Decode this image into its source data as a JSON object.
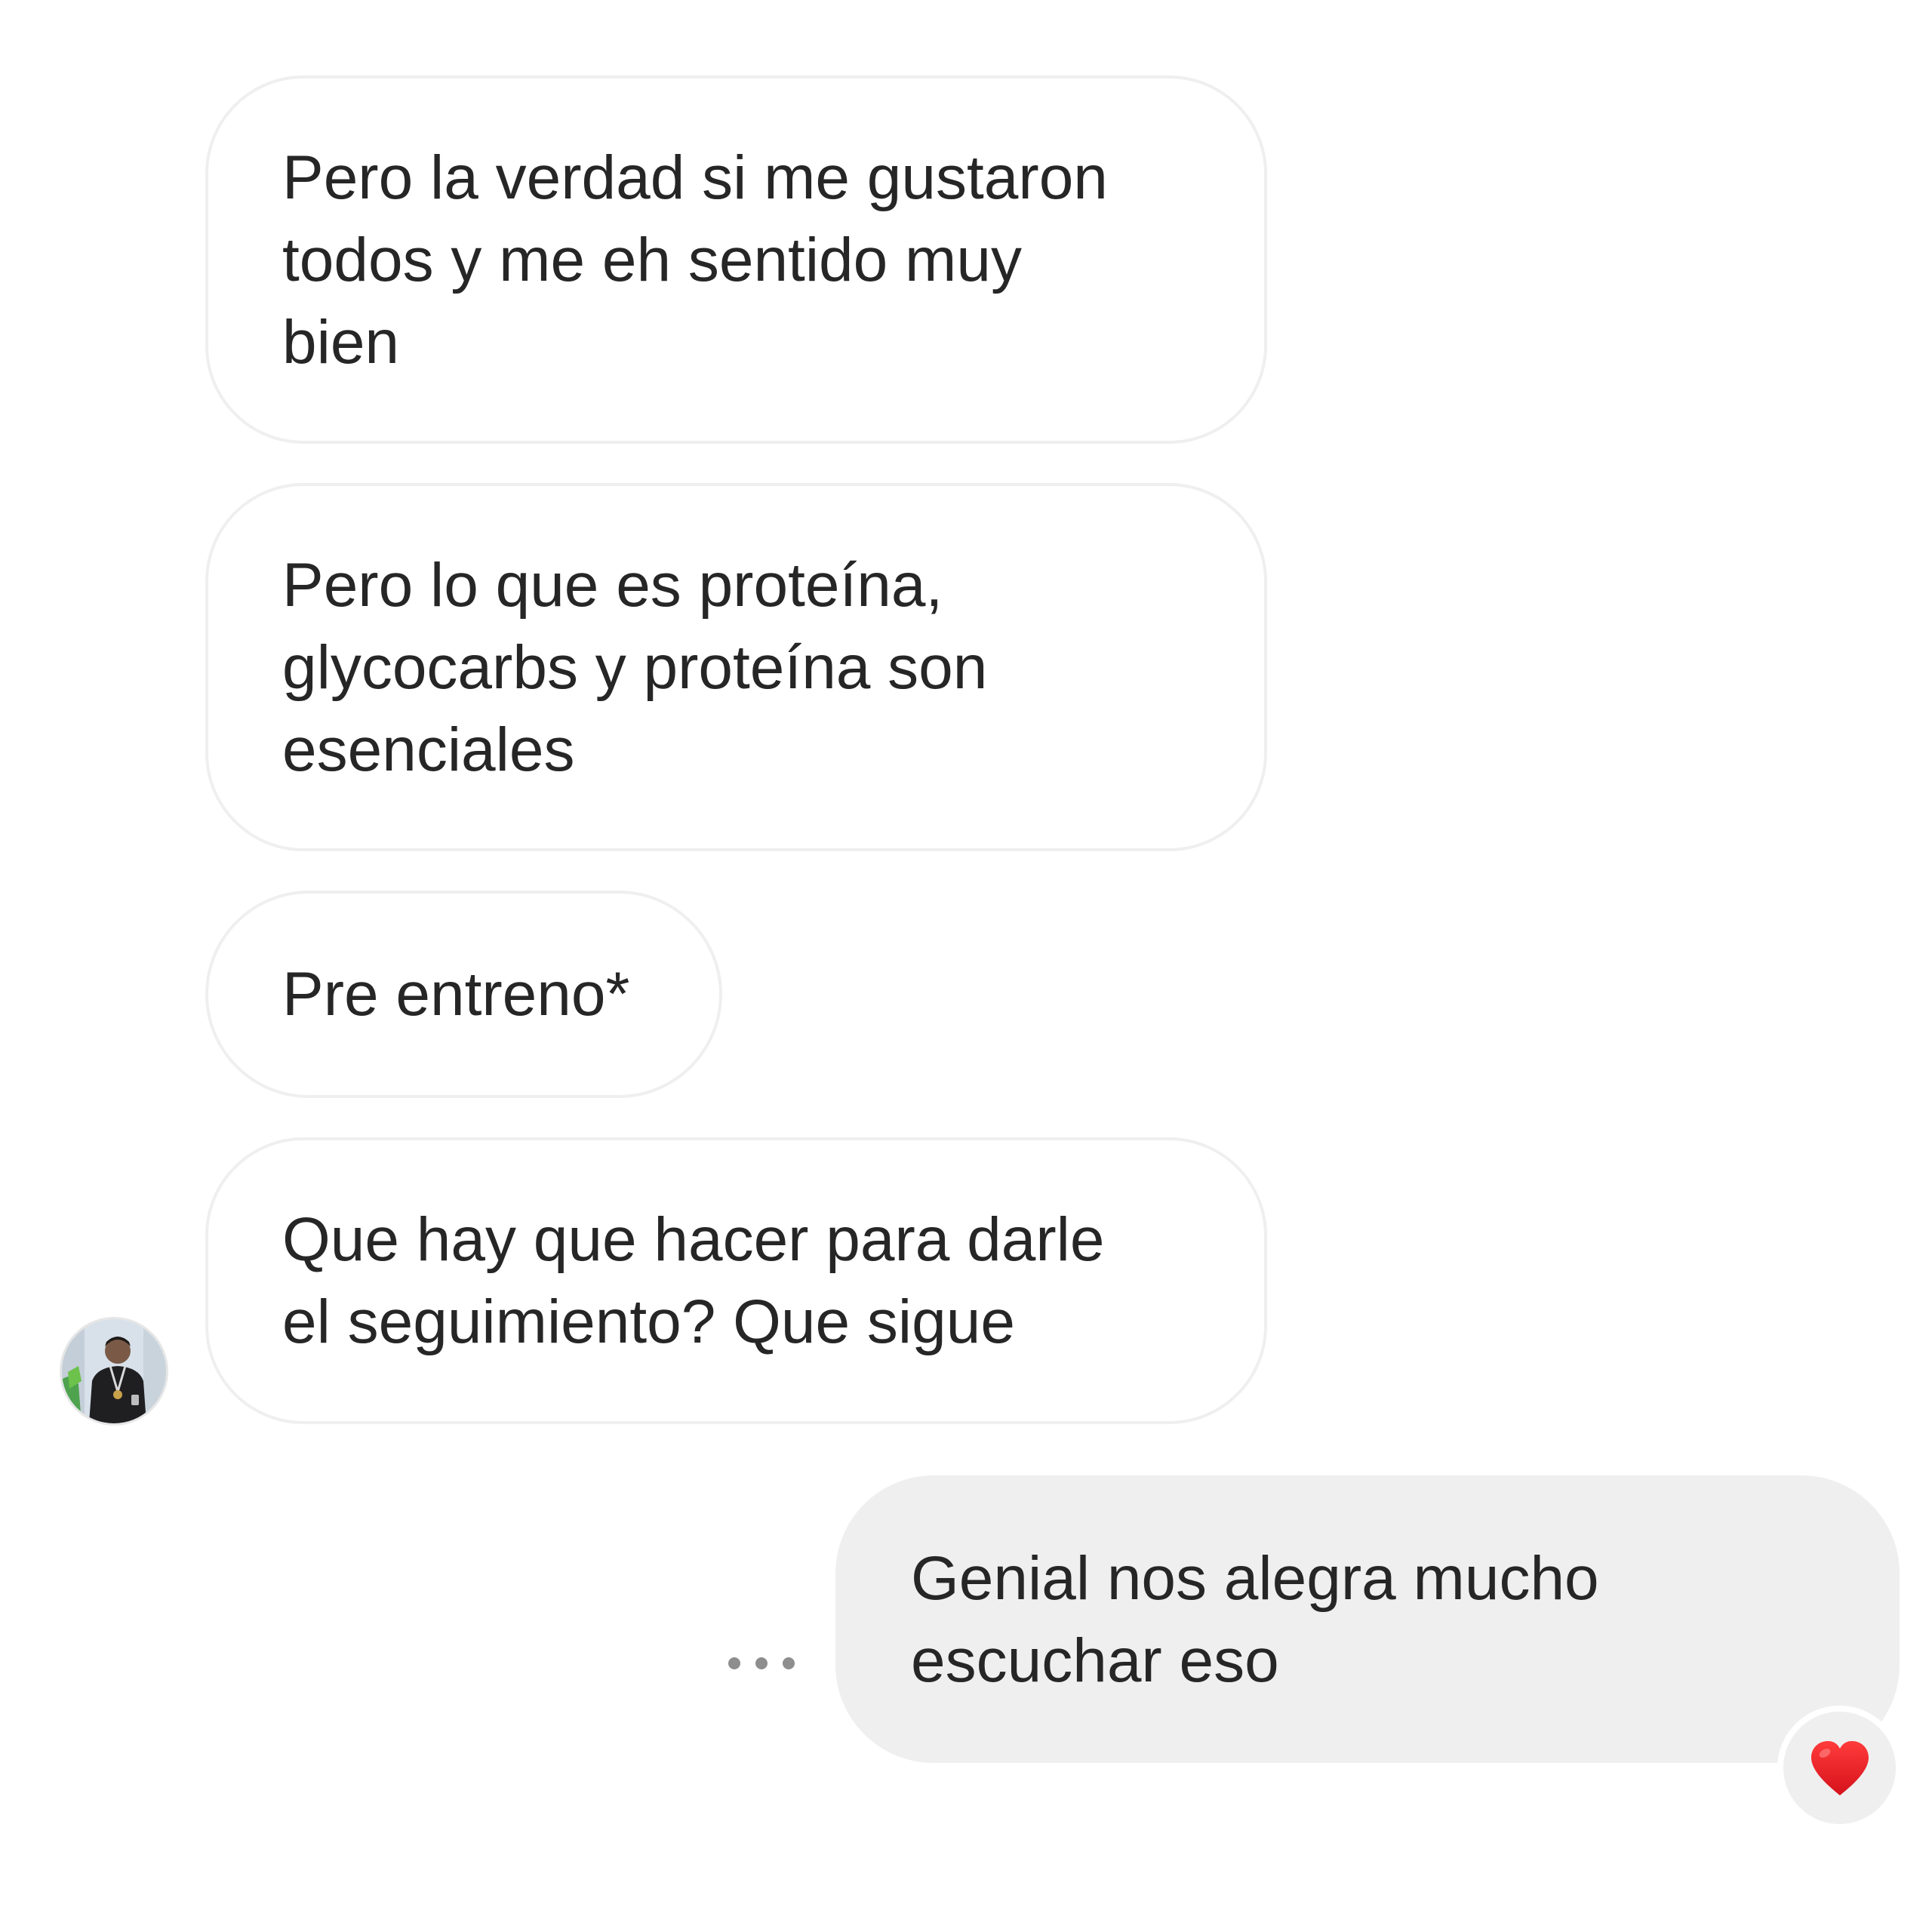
{
  "messages": [
    {
      "direction": "incoming",
      "text": "Pero la verdad si me gustaron\ntodos y me eh sentido muy\nbien"
    },
    {
      "direction": "incoming",
      "text": "Pero lo que es proteína,\nglycocarbs y proteína son\nesenciales"
    },
    {
      "direction": "incoming",
      "text": "Pre entreno*"
    },
    {
      "direction": "incoming",
      "text": "Que hay que hacer para darle\nel seguimiento? Que sigue"
    },
    {
      "direction": "outgoing",
      "text": "Genial nos alegra mucho\nescuchar eso"
    }
  ],
  "sender_avatar": "user-avatar",
  "message_actions_icon": "more-horizontal-icon",
  "reaction": {
    "icon": "heart-icon",
    "color": "#ed1c24"
  },
  "colors": {
    "incoming_bubble_bg": "#ffffff",
    "incoming_bubble_border": "#efefef",
    "outgoing_bubble_bg": "#efefef",
    "text": "#262626",
    "muted_icon": "#8e8e8e"
  }
}
